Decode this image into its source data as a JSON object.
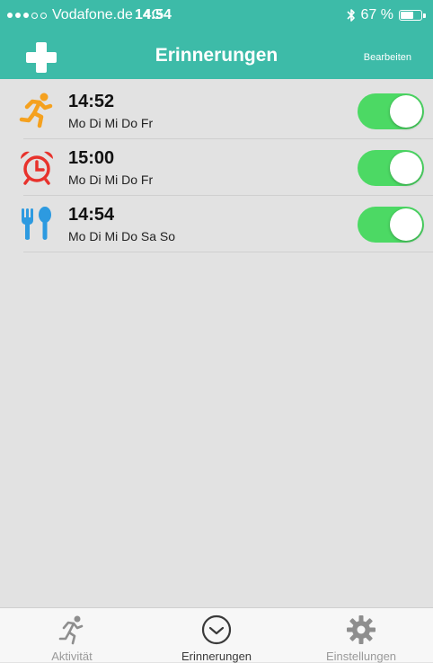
{
  "status_bar": {
    "carrier": "Vodafone.de",
    "network": "4G",
    "time": "14:54",
    "bluetooth_icon": "bluetooth-icon",
    "battery_percent": "67 %",
    "battery_level": 0.67
  },
  "nav": {
    "add_icon": "plus-icon",
    "title": "Erinnerungen",
    "edit_label": "Bearbeiten"
  },
  "reminders": [
    {
      "icon": "runner-icon",
      "time": "14:52",
      "days": "Mo Di Mi Do Fr",
      "enabled": true
    },
    {
      "icon": "alarm-clock-icon",
      "time": "15:00",
      "days": "Mo Di Mi Do Fr",
      "enabled": true
    },
    {
      "icon": "fork-spoon-icon",
      "time": "14:54",
      "days": "Mo Di Mi Do Sa So",
      "enabled": true
    }
  ],
  "tabs": [
    {
      "icon": "runner-icon",
      "label": "Aktivität",
      "active": false
    },
    {
      "icon": "clock-icon",
      "label": "Erinnerungen",
      "active": true
    },
    {
      "icon": "gear-icon",
      "label": "Einstellungen",
      "active": false
    }
  ],
  "colors": {
    "header": "#3dbba8",
    "toggle_on": "#4cd964",
    "runner": "#f5a11f",
    "alarm": "#e8322c",
    "cutlery": "#2d9ae0"
  }
}
